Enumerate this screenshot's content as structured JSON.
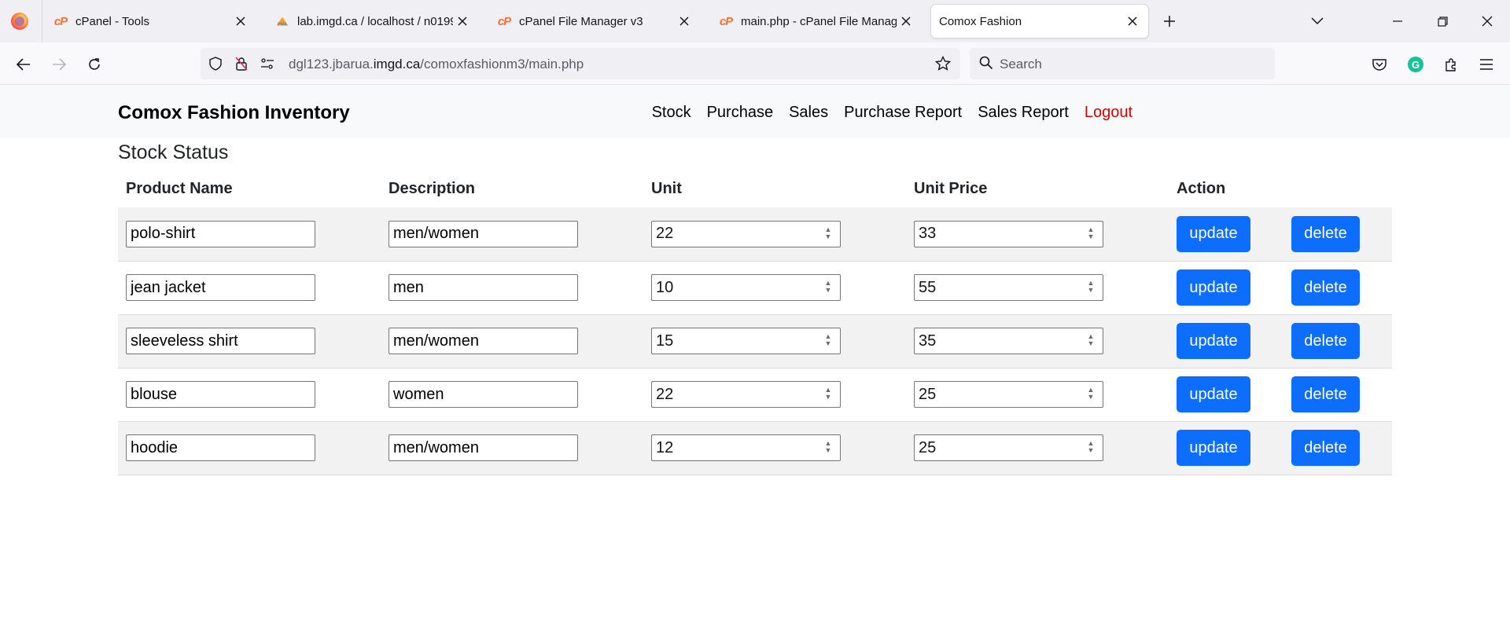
{
  "browser": {
    "tabs": [
      {
        "title": "cPanel - Tools",
        "icon": "cpanel-icon",
        "active": false
      },
      {
        "title": "lab.imgd.ca / localhost / n0199",
        "icon": "phpmyadmin-icon",
        "active": false
      },
      {
        "title": "cPanel File Manager v3",
        "icon": "cpanel-icon",
        "active": false
      },
      {
        "title": "main.php - cPanel File Manager",
        "icon": "cpanel-icon",
        "active": false
      },
      {
        "title": "Comox Fashion",
        "icon": "none",
        "active": true
      }
    ],
    "url_prefix": "dgl123.jbarua.",
    "url_domain": "imgd.ca",
    "url_path": "/comoxfashionm3/main.php",
    "search_placeholder": "Search",
    "cpanel_glyph": "cP",
    "pma_glyph": "PMA",
    "grammarly_glyph": "G"
  },
  "app": {
    "brand": "Comox Fashion Inventory",
    "menu": [
      "Stock",
      "Purchase",
      "Sales",
      "Purchase Report",
      "Sales Report",
      "Logout"
    ],
    "logout_color": "#e00000"
  },
  "page": {
    "title": "Stock Status",
    "columns": [
      "Product Name",
      "Description",
      "Unit",
      "Unit Price",
      "Action"
    ],
    "update_label": "update",
    "delete_label": "delete",
    "button_color": "#0d6efd",
    "rows": [
      {
        "name": "polo-shirt",
        "description": "men/women",
        "unit": "22",
        "price": "33"
      },
      {
        "name": "jean jacket",
        "description": "men",
        "unit": "10",
        "price": "55"
      },
      {
        "name": "sleeveless shirt",
        "description": "men/women",
        "unit": "15",
        "price": "35"
      },
      {
        "name": "blouse",
        "description": "women",
        "unit": "22",
        "price": "25"
      },
      {
        "name": "hoodie",
        "description": "men/women",
        "unit": "12",
        "price": "25"
      }
    ]
  }
}
